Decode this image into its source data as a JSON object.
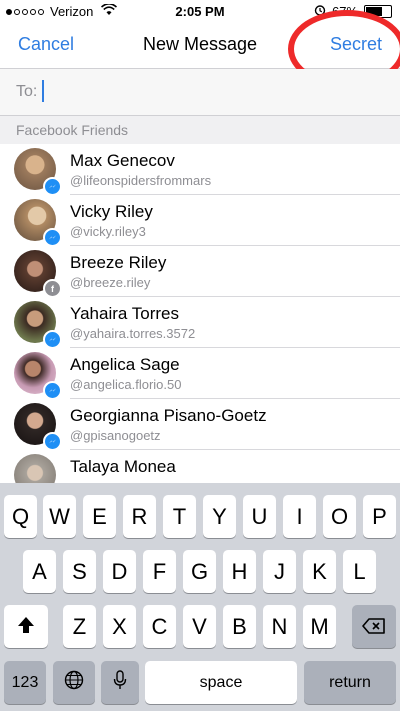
{
  "status_bar": {
    "carrier": "Verizon",
    "time": "2:05 PM",
    "battery": "67%"
  },
  "nav": {
    "cancel": "Cancel",
    "title": "New Message",
    "secret": "Secret"
  },
  "to_field": {
    "label": "To:",
    "value": ""
  },
  "section": {
    "title": "Facebook Friends"
  },
  "contacts": [
    {
      "name": "Max Genecov",
      "handle": "@lifeonspidersfrommars",
      "badge": "messenger",
      "avatar_color": "#9c7a5c"
    },
    {
      "name": "Vicky Riley",
      "handle": "@vicky.riley3",
      "badge": "messenger",
      "avatar_color": "#b08a63"
    },
    {
      "name": "Breeze Riley",
      "handle": "@breeze.riley",
      "badge": "facebook",
      "avatar_color": "#5a3b2e"
    },
    {
      "name": "Yahaira Torres",
      "handle": "@yahaira.torres.3572",
      "badge": "messenger",
      "avatar_color": "#6f7a4e"
    },
    {
      "name": "Angelica Sage",
      "handle": "@angelica.florio.50",
      "badge": "messenger",
      "avatar_color": "#c79ab3"
    },
    {
      "name": "Georgianna Pisano-Goetz",
      "handle": "@gpisanogoetz",
      "badge": "messenger",
      "avatar_color": "#2e2624"
    },
    {
      "name": "Talaya Monea",
      "handle": "",
      "badge": "",
      "avatar_color": "#a8a29a"
    }
  ],
  "keyboard": {
    "row1": [
      "Q",
      "W",
      "E",
      "R",
      "T",
      "Y",
      "U",
      "I",
      "O",
      "P"
    ],
    "row2": [
      "A",
      "S",
      "D",
      "F",
      "G",
      "H",
      "J",
      "K",
      "L"
    ],
    "row3": [
      "Z",
      "X",
      "C",
      "V",
      "B",
      "N",
      "M"
    ],
    "numbers_key": "123",
    "space_key": "space",
    "return_key": "return"
  },
  "icons": {
    "wifi": "wifi-icon",
    "alarm": "alarm-icon",
    "battery": "battery-icon",
    "messenger_badge": "messenger-icon",
    "facebook_badge": "facebook-icon",
    "shift": "shift-icon",
    "backspace": "backspace-icon",
    "globe": "globe-icon",
    "mic": "microphone-icon"
  },
  "colors": {
    "accent": "#2f7de1",
    "annotation": "#ee2a2a",
    "messenger": "#1f8ff5"
  }
}
